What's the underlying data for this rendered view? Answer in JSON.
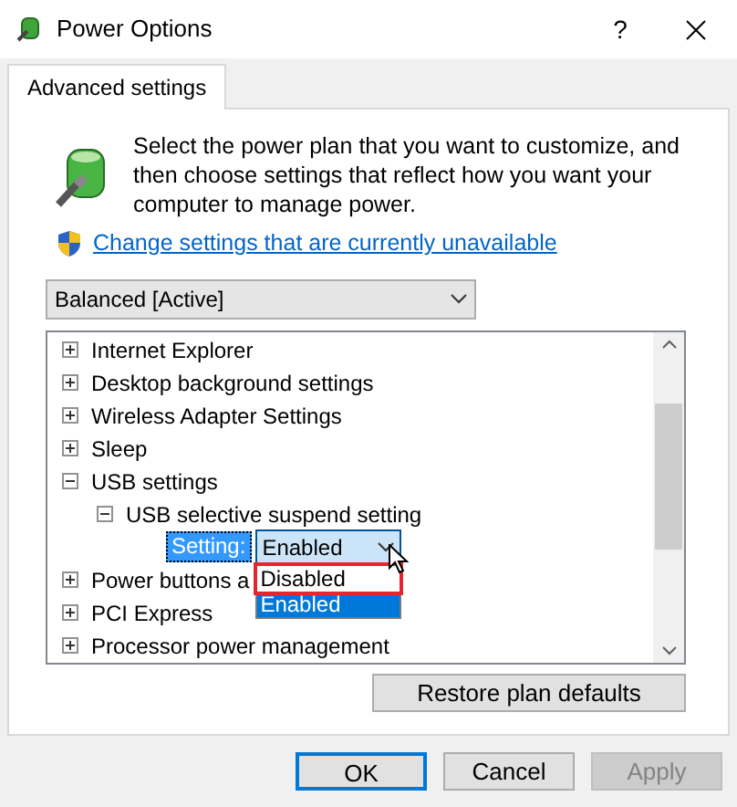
{
  "window": {
    "title": "Power Options",
    "help": "?"
  },
  "tabs": [
    {
      "label": "Advanced settings",
      "selected": true
    }
  ],
  "intro": "Select the power plan that you want to customize, and then choose settings that reflect how you want your computer to manage power.",
  "link": "Change settings that are currently unavailable",
  "plan": {
    "value": "Balanced [Active]"
  },
  "tree": [
    {
      "label": "Internet Explorer",
      "expanded": false
    },
    {
      "label": "Desktop background settings",
      "expanded": false
    },
    {
      "label": "Wireless Adapter Settings",
      "expanded": false
    },
    {
      "label": "Sleep",
      "expanded": false
    },
    {
      "label": "USB settings",
      "expanded": true,
      "children": [
        {
          "label": "USB selective suspend setting",
          "expanded": true,
          "children": [
            {
              "kind": "setting",
              "label": "Setting:",
              "value": "Enabled",
              "open": true,
              "options": [
                {
                  "label": "Disabled",
                  "selected": false,
                  "annotated": true
                },
                {
                  "label": "Enabled",
                  "selected": true,
                  "annotated": false
                }
              ]
            }
          ]
        }
      ]
    },
    {
      "label": "Power buttons a",
      "expanded": false
    },
    {
      "label": "PCI Express",
      "expanded": false
    },
    {
      "label": "Processor power management",
      "expanded": false
    }
  ],
  "restore_button": "Restore plan defaults",
  "buttons": [
    {
      "label": "OK",
      "disabled": false,
      "default": true
    },
    {
      "label": "Cancel",
      "disabled": false,
      "default": false
    },
    {
      "label": "Apply",
      "disabled": true,
      "default": false
    }
  ]
}
